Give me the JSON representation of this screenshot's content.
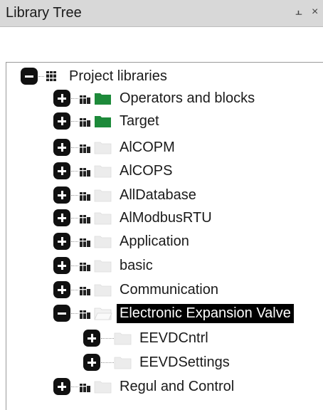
{
  "panel": {
    "title": "Library Tree",
    "pin_glyph": "⫠",
    "close_glyph": "×"
  },
  "tree": {
    "root": {
      "label": "Project libraries",
      "expanded": true,
      "icon": "library-icon"
    },
    "items": [
      {
        "label": "Operators and blocks",
        "expanded": false,
        "folder": "green"
      },
      {
        "label": "Target",
        "expanded": false,
        "folder": "green"
      },
      {
        "label": "AlCOPM",
        "expanded": false,
        "folder": "grey"
      },
      {
        "label": "AlCOPS",
        "expanded": false,
        "folder": "grey"
      },
      {
        "label": "AllDatabase",
        "expanded": false,
        "folder": "grey"
      },
      {
        "label": "AlModbusRTU",
        "expanded": false,
        "folder": "grey"
      },
      {
        "label": "Application",
        "expanded": false,
        "folder": "grey"
      },
      {
        "label": "basic",
        "expanded": false,
        "folder": "grey"
      },
      {
        "label": "Communication",
        "expanded": false,
        "folder": "grey"
      },
      {
        "label": "Electronic Expansion Valve",
        "expanded": true,
        "folder": "grey",
        "selected": true,
        "children": [
          {
            "label": "EEVDCntrl",
            "expanded": false
          },
          {
            "label": "EEVDSettings",
            "expanded": false
          }
        ]
      },
      {
        "label": "Regul and Control",
        "expanded": false,
        "folder": "grey"
      }
    ]
  },
  "colors": {
    "folder_green": "#1d8a3a",
    "folder_grey": "#e6e6e6",
    "selection_bg": "#000000",
    "selection_fg": "#ffffff"
  }
}
